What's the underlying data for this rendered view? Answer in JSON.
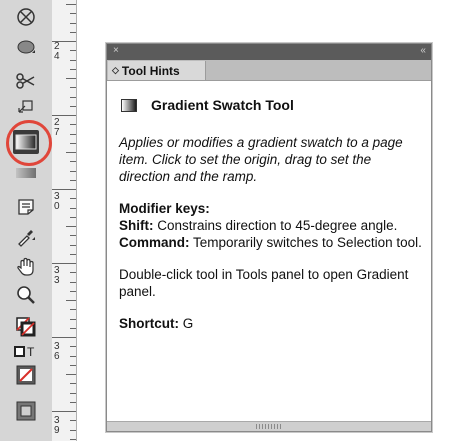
{
  "tools_panel": {
    "icons": [
      "ellipse-frame-icon",
      "ellipse-icon",
      "scissors-icon",
      "free-transform-icon",
      "gradient-swatch-tool-icon",
      "gradient-feather-icon",
      "note-icon",
      "eyedropper-icon",
      "hand-icon",
      "zoom-icon",
      "fill-stroke-icon",
      "formatting-container-icon",
      "apply-none-icon",
      "screen-mode-icon"
    ],
    "selected_tool": "gradient-swatch-tool-icon",
    "highlight_color": "#e0463a"
  },
  "ruler": {
    "labels": [
      "2 4",
      "2 7",
      "3 0",
      "3 3",
      "3 6",
      "3 9"
    ]
  },
  "tool_hints": {
    "tab_label": "Tool Hints",
    "tool_name": "Gradient Swatch Tool",
    "description": "Applies or modifies a gradient swatch to a page item. Click to set the origin, drag to set the direction and the ramp.",
    "modifier_heading": "Modifier keys:",
    "modifiers": [
      {
        "key": "Shift:",
        "text": " Constrains direction to 45-degree angle."
      },
      {
        "key": "Command:",
        "text": " Temporarily switches to Selection tool."
      }
    ],
    "double_click_note": "Double-click tool in Tools panel to open Gradient panel.",
    "shortcut_label": "Shortcut:",
    "shortcut_key": " G"
  }
}
